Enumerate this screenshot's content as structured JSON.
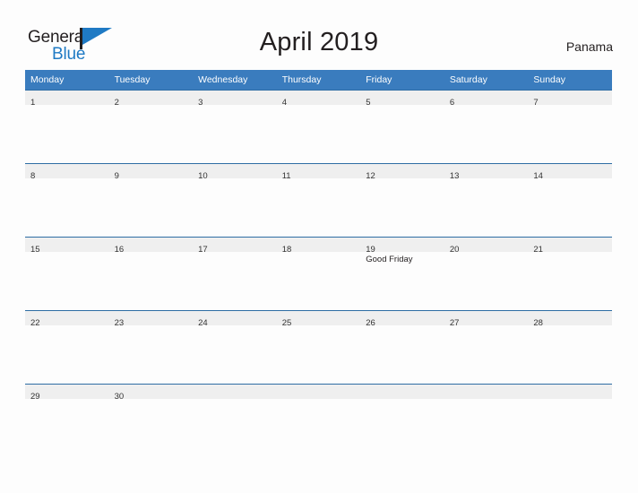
{
  "brand": {
    "name_line1": "General",
    "name_line2": "Blue",
    "dark_color": "#231f20",
    "blue_color": "#1f7ac4"
  },
  "header": {
    "title": "April 2019",
    "locale": "Panama",
    "header_bg": "#3a7cbe",
    "band_bg": "#efefef"
  },
  "weekdays": [
    "Monday",
    "Tuesday",
    "Wednesday",
    "Thursday",
    "Friday",
    "Saturday",
    "Sunday"
  ],
  "weeks": [
    [
      {
        "day": "1",
        "events": []
      },
      {
        "day": "2",
        "events": []
      },
      {
        "day": "3",
        "events": []
      },
      {
        "day": "4",
        "events": []
      },
      {
        "day": "5",
        "events": []
      },
      {
        "day": "6",
        "events": []
      },
      {
        "day": "7",
        "events": []
      }
    ],
    [
      {
        "day": "8",
        "events": []
      },
      {
        "day": "9",
        "events": []
      },
      {
        "day": "10",
        "events": []
      },
      {
        "day": "11",
        "events": []
      },
      {
        "day": "12",
        "events": []
      },
      {
        "day": "13",
        "events": []
      },
      {
        "day": "14",
        "events": []
      }
    ],
    [
      {
        "day": "15",
        "events": []
      },
      {
        "day": "16",
        "events": []
      },
      {
        "day": "17",
        "events": []
      },
      {
        "day": "18",
        "events": []
      },
      {
        "day": "19",
        "events": [
          "Good Friday"
        ]
      },
      {
        "day": "20",
        "events": []
      },
      {
        "day": "21",
        "events": []
      }
    ],
    [
      {
        "day": "22",
        "events": []
      },
      {
        "day": "23",
        "events": []
      },
      {
        "day": "24",
        "events": []
      },
      {
        "day": "25",
        "events": []
      },
      {
        "day": "26",
        "events": []
      },
      {
        "day": "27",
        "events": []
      },
      {
        "day": "28",
        "events": []
      }
    ],
    [
      {
        "day": "29",
        "events": []
      },
      {
        "day": "30",
        "events": []
      },
      {
        "day": "",
        "events": []
      },
      {
        "day": "",
        "events": []
      },
      {
        "day": "",
        "events": []
      },
      {
        "day": "",
        "events": []
      },
      {
        "day": "",
        "events": []
      }
    ]
  ]
}
